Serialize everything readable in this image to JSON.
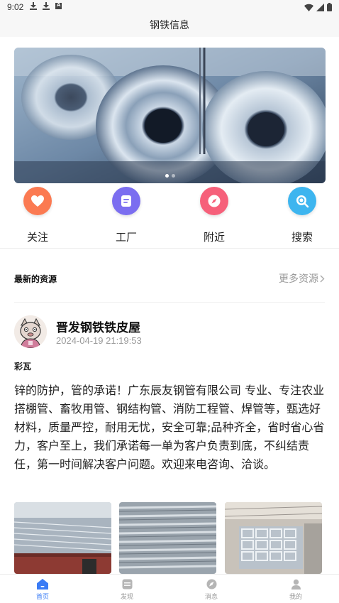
{
  "status_bar": {
    "time": "9:02"
  },
  "header": {
    "title": "钢铁信息"
  },
  "banner": {
    "image_desc_icon": "steel-coil-photo",
    "pages": 2,
    "active_page": 1
  },
  "quick_nav": [
    {
      "label": "关注",
      "icon": "heart-icon",
      "color": "#fb7a52"
    },
    {
      "label": "工厂",
      "icon": "document-icon",
      "color": "#7b6ef0"
    },
    {
      "label": "附近",
      "icon": "compass-icon",
      "color": "#f6607a"
    },
    {
      "label": "搜索",
      "icon": "search-icon",
      "color": "#3db5ef"
    }
  ],
  "section": {
    "title": "最新的资源",
    "more": "更多资源"
  },
  "post": {
    "name": "晋发钢铁铁皮屋",
    "time": "2024-04-19 21:19:53",
    "tag": "彩瓦",
    "body": "锌的防护，管的承诺！广东辰友钢管有限公司 专业、专注农业搭棚管、畜牧用管、钢结构管、消防工程管、焊管等，甄选好材料，质量严控，耐用无忧，安全可靠;品种齐全，省时省心省力，客户至上，我们承诺每一单为客户负责到底，不纠结责任，第一时间解决客户问题。欢迎来电咨询、洽谈。"
  },
  "tabs": [
    {
      "label": "首页",
      "icon": "home-icon",
      "active": true
    },
    {
      "label": "发现",
      "icon": "discover-icon",
      "active": false
    },
    {
      "label": "消息",
      "icon": "message-icon",
      "active": false
    },
    {
      "label": "我的",
      "icon": "user-icon",
      "active": false
    }
  ],
  "colors": {
    "accent": "#3b7cf5",
    "muted": "#999999"
  }
}
